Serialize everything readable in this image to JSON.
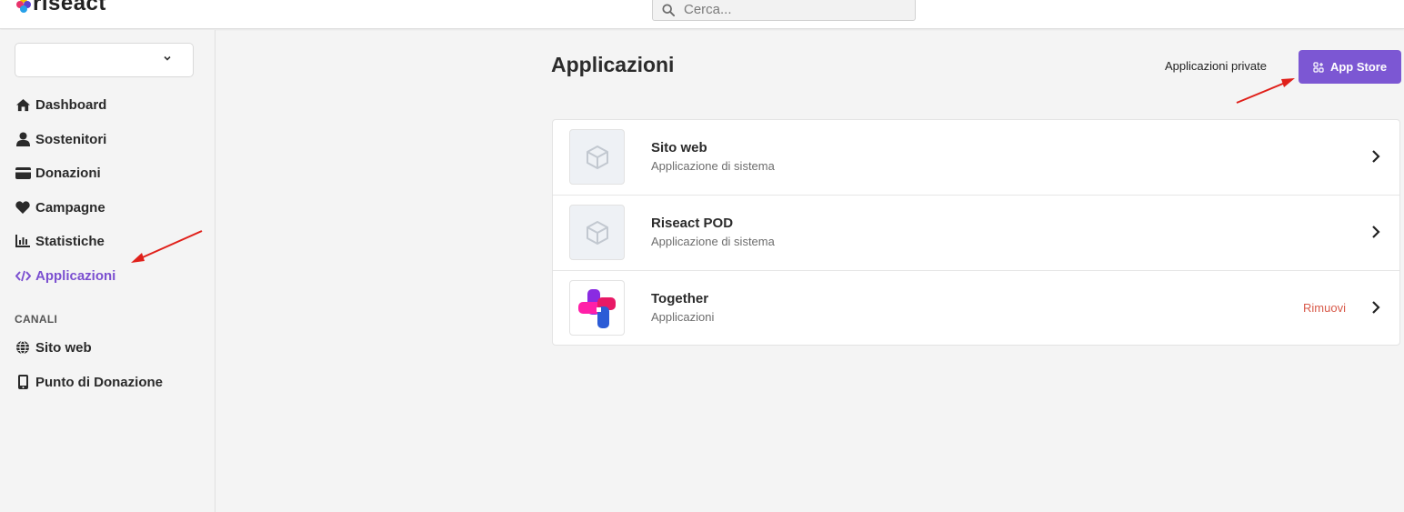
{
  "brand": {
    "name": "riseact"
  },
  "search": {
    "placeholder": "Cerca..."
  },
  "sidebar": {
    "store_select_value": "",
    "items": [
      {
        "label": "Dashboard",
        "icon": "home-icon"
      },
      {
        "label": "Sostenitori",
        "icon": "user-icon"
      },
      {
        "label": "Donazioni",
        "icon": "credit-card-icon"
      },
      {
        "label": "Campagne",
        "icon": "heart-icon"
      },
      {
        "label": "Statistiche",
        "icon": "bar-chart-icon"
      },
      {
        "label": "Applicazioni",
        "icon": "code-icon",
        "active": true
      }
    ],
    "channels_label": "CANALI",
    "channels": [
      {
        "label": "Sito web",
        "icon": "globe-icon"
      },
      {
        "label": "Punto di Donazione",
        "icon": "mobile-icon"
      }
    ]
  },
  "main": {
    "title": "Applicazioni",
    "private_apps_label": "Applicazioni private",
    "app_store_label": "App Store",
    "apps": [
      {
        "name": "Sito web",
        "subtitle": "Applicazione di sistema",
        "icon": "cube-icon"
      },
      {
        "name": "Riseact POD",
        "subtitle": "Applicazione di sistema",
        "icon": "cube-icon"
      },
      {
        "name": "Together",
        "subtitle": "Applicazioni",
        "icon": "together-logo",
        "action": "Rimuovi"
      }
    ]
  },
  "colors": {
    "accent": "#7c57d3",
    "active_nav": "#7b4fd0",
    "danger": "#d85a4a",
    "annotation_arrow": "#e0201a"
  }
}
